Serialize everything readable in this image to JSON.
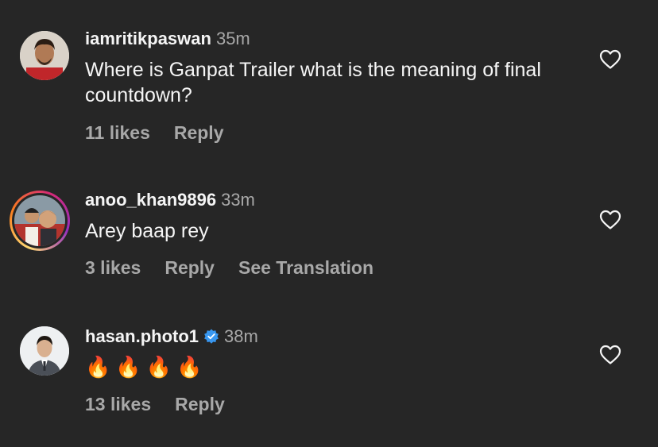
{
  "comments": [
    {
      "username": "iamritikpaswan",
      "time": "35m",
      "text": "Where is Ganpat Trailer what is the meaning of final countdown?",
      "likes": "11 likes",
      "reply": "Reply"
    },
    {
      "username": "anoo_khan9896",
      "time": "33m",
      "text": "Arey baap rey",
      "likes": "3 likes",
      "reply": "Reply",
      "translate": "See Translation"
    },
    {
      "username": "hasan.photo1",
      "time": "38m",
      "text": "🔥🔥🔥🔥",
      "likes": "13 likes",
      "reply": "Reply",
      "verified": true
    }
  ],
  "colors": {
    "background": "#262626",
    "primary_text": "#f5f5f5",
    "secondary_text": "#a8a8a8",
    "verified_blue": "#3897f0"
  },
  "icons": [
    "heart-icon",
    "verified-badge-icon"
  ]
}
